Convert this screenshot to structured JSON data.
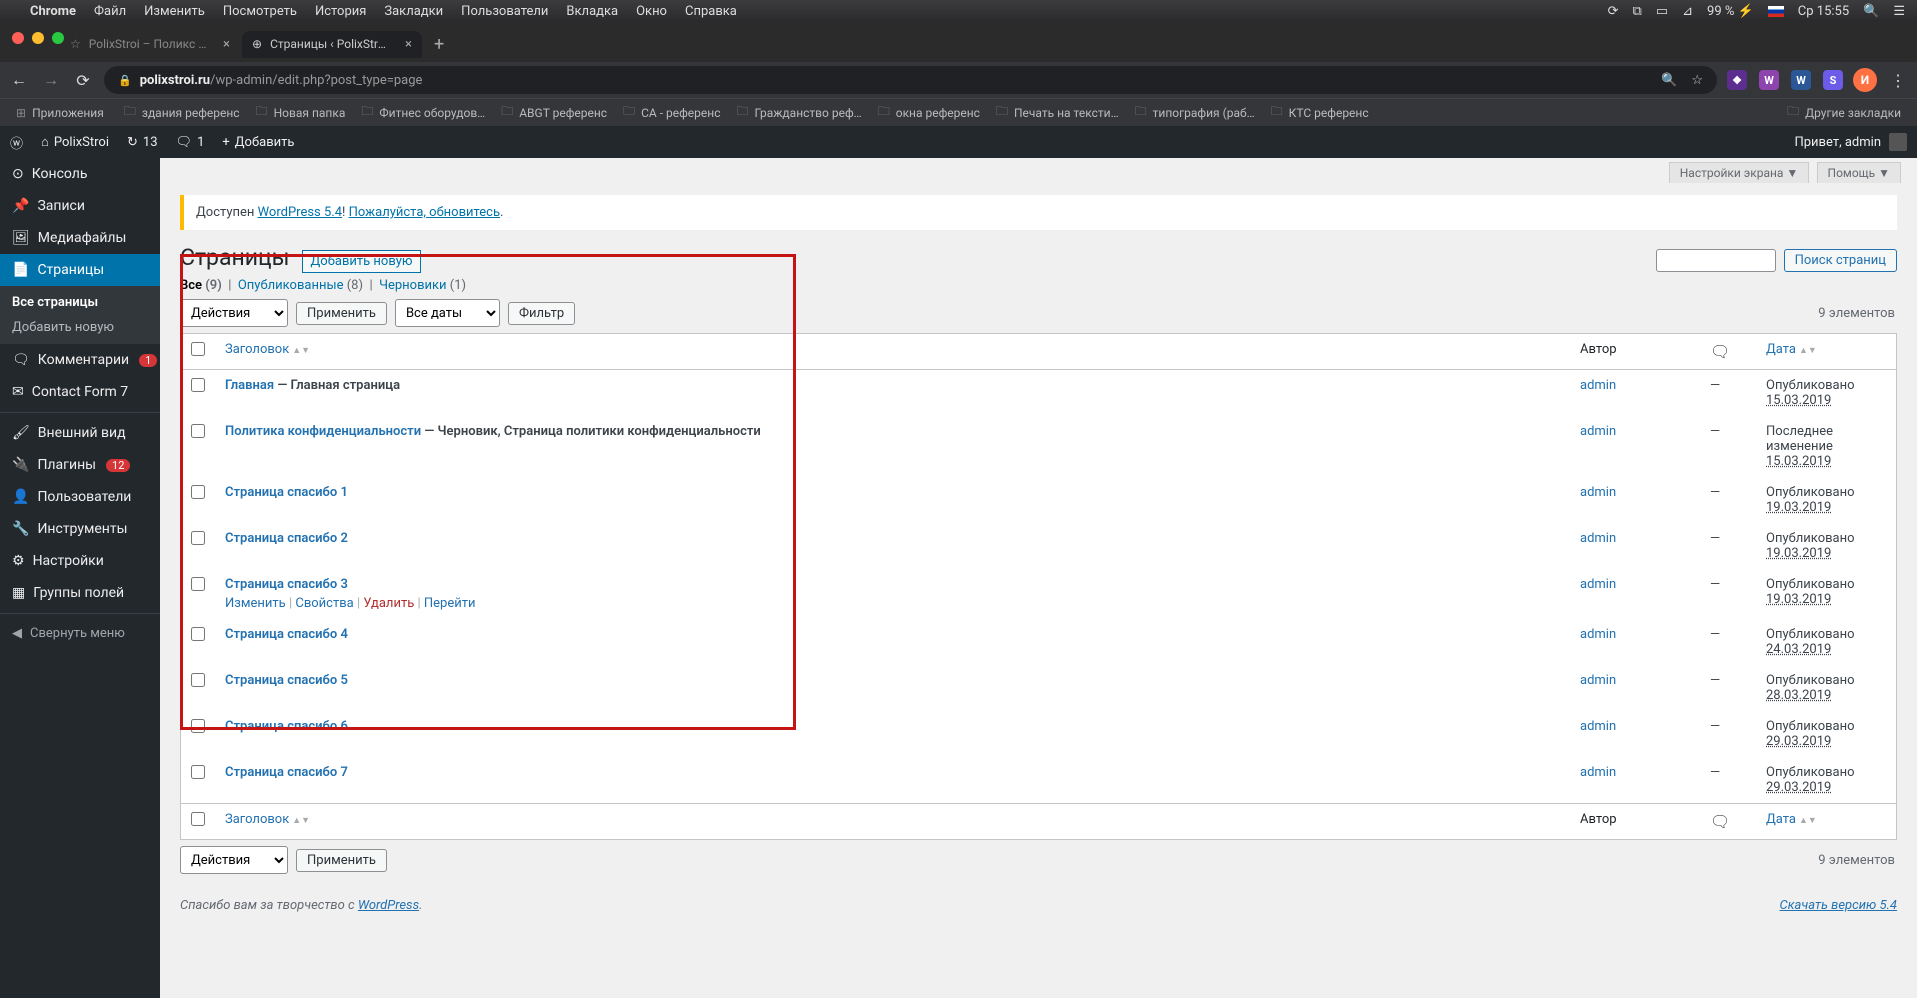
{
  "macos": {
    "app": "Chrome",
    "menus": [
      "Файл",
      "Изменить",
      "Посмотреть",
      "История",
      "Закладки",
      "Пользователи",
      "Вкладка",
      "Окно",
      "Справка"
    ],
    "battery": "99 %",
    "clock": "Ср 15:55"
  },
  "chrome": {
    "tabs": [
      {
        "title": "PolixStroi – Поликс Строй – с…",
        "active": false
      },
      {
        "title": "Страницы ‹ PolixStroi — Word…",
        "active": true
      }
    ],
    "url_host": "polixstroi.ru",
    "url_path": "/wp-admin/edit.php?post_type=page",
    "bookmarks": [
      "здания референс",
      "Новая папка",
      "Фитнес оборудов…",
      "ABGT референс",
      "CA - референс",
      "Гражданство реф…",
      "окна референс",
      "Печать на тексти…",
      "типография (раб…",
      "КТС референс"
    ],
    "apps_label": "Приложения",
    "other_bookmarks": "Другие закладки",
    "avatar_letter": "И"
  },
  "adminbar": {
    "site": "PolixStroi",
    "updates": "13",
    "comments": "1",
    "add_new": "Добавить",
    "greeting": "Привет, admin"
  },
  "sidebar": {
    "items": [
      {
        "icon": "dashboard",
        "label": "Консоль"
      },
      {
        "icon": "pin",
        "label": "Записи"
      },
      {
        "icon": "media",
        "label": "Медиафайлы"
      },
      {
        "icon": "page",
        "label": "Страницы",
        "current": true,
        "submenu": [
          {
            "label": "Все страницы",
            "current": true
          },
          {
            "label": "Добавить новую"
          }
        ]
      },
      {
        "icon": "comment",
        "label": "Комментарии",
        "badge": "1"
      },
      {
        "icon": "mail",
        "label": "Contact Form 7"
      },
      {
        "separator": true
      },
      {
        "icon": "brush",
        "label": "Внешний вид"
      },
      {
        "icon": "plugin",
        "label": "Плагины",
        "badge": "12"
      },
      {
        "icon": "user",
        "label": "Пользователи"
      },
      {
        "icon": "tool",
        "label": "Инструменты"
      },
      {
        "icon": "settings",
        "label": "Настройки"
      },
      {
        "icon": "group",
        "label": "Группы полей"
      }
    ],
    "collapse": "Свернуть меню"
  },
  "screen_tabs": {
    "options": "Настройки экрана",
    "help": "Помощь"
  },
  "notice": {
    "prefix": "Доступен ",
    "link1": "WordPress 5.4",
    "sep": "! ",
    "link2": "Пожалуйста, обновитесь",
    "suffix": "."
  },
  "header": {
    "title": "Страницы",
    "add_new": "Добавить новую"
  },
  "filters": {
    "all": "Все",
    "all_count": "(9)",
    "pub": "Опубликованные",
    "pub_count": "(8)",
    "draft": "Черновики",
    "draft_count": "(1)",
    "bulk": "Действия",
    "apply": "Применить",
    "dates": "Все даты",
    "filter": "Фильтр",
    "count_label": "9 элементов"
  },
  "search": {
    "placeholder": "",
    "button": "Поиск страниц"
  },
  "columns": {
    "title": "Заголовок",
    "author": "Автор",
    "date": "Дата"
  },
  "rows": [
    {
      "title": "Главная",
      "state": " — Главная страница",
      "author": "admin",
      "comments": "—",
      "date_label": "Опубликовано",
      "date": "15.03.2019"
    },
    {
      "title": "Политика конфиденциальности",
      "state": " — Черновик, Страница политики конфиденциальности",
      "author": "admin",
      "comments": "—",
      "date_label": "Последнее изменение",
      "date": "15.03.2019"
    },
    {
      "title": "Страница спасибо 1",
      "author": "admin",
      "comments": "—",
      "date_label": "Опубликовано",
      "date": "19.03.2019"
    },
    {
      "title": "Страница спасибо 2",
      "author": "admin",
      "comments": "—",
      "date_label": "Опубликовано",
      "date": "19.03.2019"
    },
    {
      "title": "Страница спасибо 3",
      "author": "admin",
      "comments": "—",
      "date_label": "Опубликовано",
      "date": "19.03.2019",
      "show_actions": true
    },
    {
      "title": "Страница спасибо 4",
      "author": "admin",
      "comments": "—",
      "date_label": "Опубликовано",
      "date": "24.03.2019"
    },
    {
      "title": "Страница спасибо 5",
      "author": "admin",
      "comments": "—",
      "date_label": "Опубликовано",
      "date": "28.03.2019"
    },
    {
      "title": "Страница спасибо 6",
      "author": "admin",
      "comments": "—",
      "date_label": "Опубликовано",
      "date": "29.03.2019"
    },
    {
      "title": "Страница спасибо 7",
      "author": "admin",
      "comments": "—",
      "date_label": "Опубликовано",
      "date": "29.03.2019"
    }
  ],
  "row_actions": {
    "edit": "Изменить",
    "quick": "Свойства",
    "trash": "Удалить",
    "view": "Перейти"
  },
  "footer": {
    "thanks_prefix": "Спасибо вам за творчество с ",
    "thanks_link": "WordPress",
    "version": "Скачать версию 5.4"
  }
}
